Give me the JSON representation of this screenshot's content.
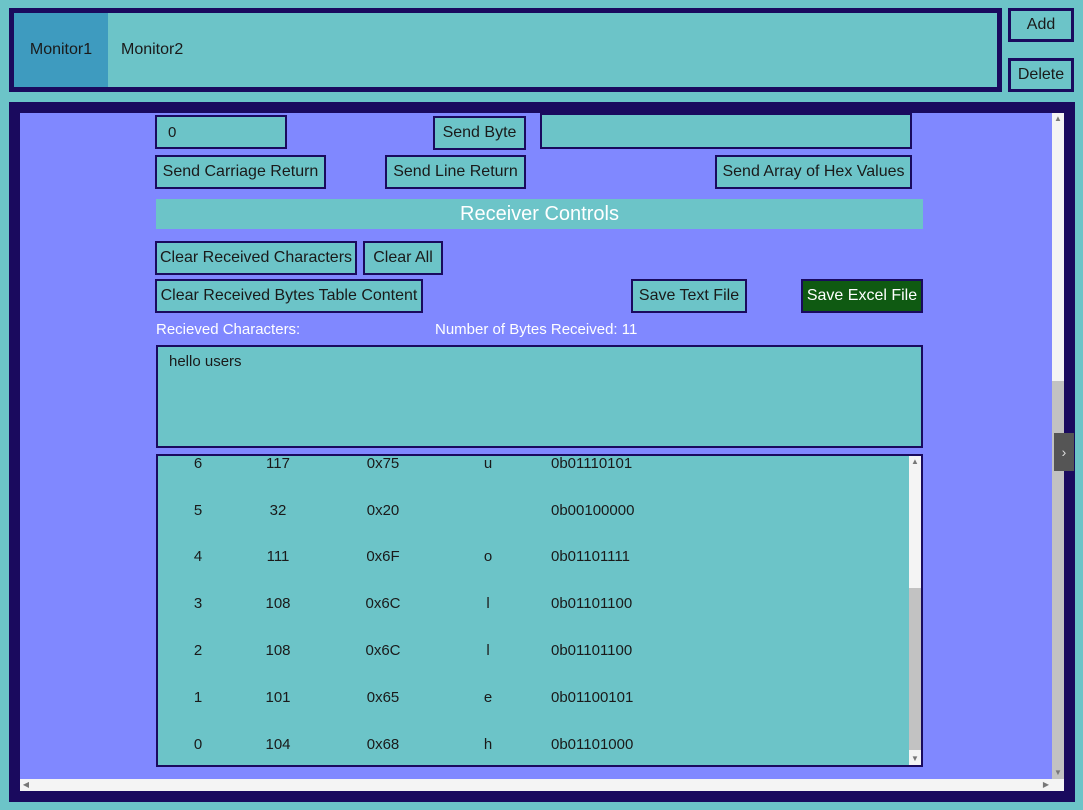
{
  "tabs": [
    {
      "label": "Monitor1",
      "active": true
    },
    {
      "label": "Monitor2",
      "active": false
    }
  ],
  "side_buttons": {
    "add": "Add",
    "delete": "Delete"
  },
  "sender": {
    "byte_value": "0",
    "send_byte": "Send Byte",
    "hex_array_value": "",
    "send_carriage_return": "Send Carriage Return",
    "send_line_return": "Send Line Return",
    "send_hex_array": "Send Array of Hex Values"
  },
  "receiver": {
    "header": "Receiver Controls",
    "clear_chars": "Clear Received Characters",
    "clear_all": "Clear All",
    "clear_bytes_table": "Clear Received Bytes Table Content",
    "save_text": "Save Text File",
    "save_excel": "Save Excel File",
    "received_chars_label": "Recieved Characters:",
    "bytes_count_label": "Number of Bytes Received: 11",
    "received_text": "hello users",
    "rows": [
      {
        "index": "6",
        "dec": "117",
        "hex": "0x75",
        "char": "u",
        "bin": "0b01110101"
      },
      {
        "index": "5",
        "dec": "32",
        "hex": "0x20",
        "char": "",
        "bin": "0b00100000"
      },
      {
        "index": "4",
        "dec": "111",
        "hex": "0x6F",
        "char": "o",
        "bin": "0b01101111"
      },
      {
        "index": "3",
        "dec": "108",
        "hex": "0x6C",
        "char": "l",
        "bin": "0b01101100"
      },
      {
        "index": "2",
        "dec": "108",
        "hex": "0x6C",
        "char": "l",
        "bin": "0b01101100"
      },
      {
        "index": "1",
        "dec": "101",
        "hex": "0x65",
        "char": "e",
        "bin": "0b01100101"
      },
      {
        "index": "0",
        "dec": "104",
        "hex": "0x68",
        "char": "h",
        "bin": "0b01101000"
      }
    ]
  },
  "colors": {
    "background": "#6cc4c8",
    "panel": "#8088ff",
    "border": "#1a0a5e",
    "active_tab": "#3e9bbf",
    "save_excel_bg": "#0f5a12"
  }
}
